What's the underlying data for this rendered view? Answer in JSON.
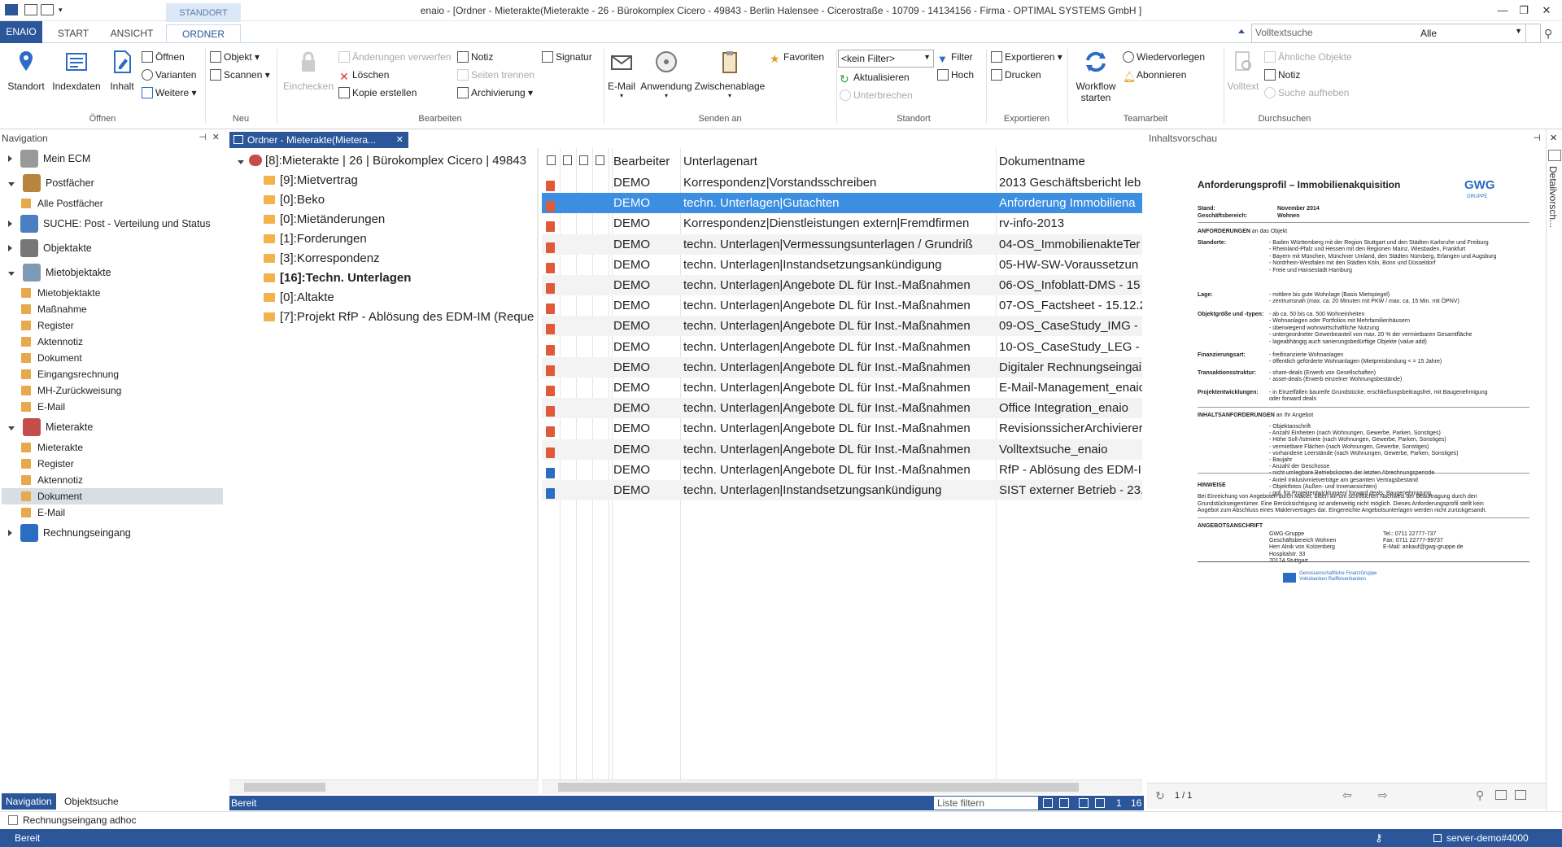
{
  "window": {
    "title": "enaio  - [Ordner - Mieterakte(Mieterakte - 26 - Bürokomplex Cicero - 49843 - Berlin Halensee - Cicerostraße - 10709 - 14134156 - Firma - OPTIMAL SYSTEMS GmbH ]",
    "minimize": "—",
    "restore": "❐",
    "close": "✕"
  },
  "ribbon_tabs": {
    "enaio": "ENAIO",
    "start": "START",
    "ansicht": "ANSICHT",
    "context_group": "STANDORT",
    "ordner": "ORDNER"
  },
  "search": {
    "placeholder": "Volltextsuche",
    "scope": "Alle"
  },
  "ribbon": {
    "oeffnen": {
      "label": "Öffnen",
      "standort": "Standort",
      "indexdaten": "Indexdaten",
      "inhalt": "Inhalt",
      "oeffnen_btn": "Öffnen",
      "varianten": "Varianten",
      "weitere": "Weitere"
    },
    "neu": {
      "label": "Neu",
      "objekt": "Objekt",
      "scannen": "Scannen"
    },
    "bearbeiten": {
      "label": "Bearbeiten",
      "einchecken": "Einchecken",
      "aenderungen": "Änderungen verwerfen",
      "loeschen": "Löschen",
      "kopie": "Kopie erstellen",
      "notiz": "Notiz",
      "seiten": "Seiten trennen",
      "archivierung": "Archivierung",
      "signatur": "Signatur"
    },
    "senden": {
      "label": "Senden an",
      "email": "E-Mail",
      "anwendung": "Anwendung",
      "zwischenablage": "Zwischenablage",
      "favoriten": "Favoriten"
    },
    "standort": {
      "label": "Standort",
      "filter_value": "<kein Filter>",
      "filter": "Filter",
      "hoch": "Hoch",
      "aktualisieren": "Aktualisieren",
      "unterbrechen": "Unterbrechen"
    },
    "exportieren": {
      "label": "Exportieren",
      "exportieren": "Exportieren",
      "drucken": "Drucken"
    },
    "teamarbeit": {
      "label": "Teamarbeit",
      "workflow": "Workflow starten",
      "wiedervorlegen": "Wiedervorlegen",
      "abonnieren": "Abonnieren"
    },
    "durchsuchen": {
      "label": "Durchsuchen",
      "volltext": "Volltext",
      "aehnliche": "Ähnliche Objekte",
      "notiz": "Notiz",
      "suche_aufheben": "Suche aufheben"
    }
  },
  "navigation": {
    "header": "Navigation",
    "items": [
      {
        "label": "Mein ECM",
        "level": 0
      },
      {
        "label": "Postfächer",
        "level": 0
      },
      {
        "label": "Alle Postfächer",
        "level": 1
      },
      {
        "label": "SUCHE: Post - Verteilung und Status",
        "level": 0
      },
      {
        "label": "Objektakte",
        "level": 0
      },
      {
        "label": "Mietobjektakte",
        "level": 0
      },
      {
        "label": "Mietobjektakte",
        "level": 1
      },
      {
        "label": "Maßnahme",
        "level": 1
      },
      {
        "label": "Register",
        "level": 1
      },
      {
        "label": "Aktennotiz",
        "level": 1
      },
      {
        "label": "Dokument",
        "level": 1
      },
      {
        "label": "Eingangsrechnung",
        "level": 1
      },
      {
        "label": "MH-Zurückweisung",
        "level": 1
      },
      {
        "label": "E-Mail",
        "level": 1
      },
      {
        "label": "Mieterakte",
        "level": 0
      },
      {
        "label": "Mieterakte",
        "level": 1
      },
      {
        "label": "Register",
        "level": 1
      },
      {
        "label": "Aktennotiz",
        "level": 1
      },
      {
        "label": "Dokument",
        "level": 1
      },
      {
        "label": "E-Mail",
        "level": 1
      },
      {
        "label": "Rechnungseingang",
        "level": 0
      }
    ],
    "tab_navigation": "Navigation",
    "tab_objektsuche": "Objektsuche"
  },
  "document_tab": "Ordner - Mieterakte(Mietera...",
  "folder_tree": {
    "root": "[8]:Mieterakte | 26 | Bürokomplex Cicero | 49843",
    "children": [
      "[9]:Mietvertrag",
      "[0]:Beko",
      "[0]:Mietänderungen",
      "[1]:Forderungen",
      "[3]:Korrespondenz",
      "[16]:Techn. Unterlagen",
      "[0]:Altakte",
      "[7]:Projekt RfP - Ablösung des EDM-IM (Reque"
    ]
  },
  "grid": {
    "columns": [
      "Bearbeiter",
      "Unterlagenart",
      "Dokumentname"
    ],
    "rows": [
      {
        "type": "pdf",
        "bearbeiter": "DEMO",
        "art": "Korrespondenz|Vorstandsschreiben",
        "name": "2013 Geschäftsbericht leb"
      },
      {
        "type": "pdf",
        "bearbeiter": "DEMO",
        "art": "techn. Unterlagen|Gutachten",
        "name": "Anforderung Immobiliena"
      },
      {
        "type": "pdf",
        "bearbeiter": "DEMO",
        "art": "Korrespondenz|Dienstleistungen extern|Fremdfirmen",
        "name": "rv-info-2013"
      },
      {
        "type": "pdf",
        "bearbeiter": "DEMO",
        "art": "techn. Unterlagen|Vermessungsunterlagen / Grundriß",
        "name": "04-OS_ImmobilienakteTer"
      },
      {
        "type": "pdf",
        "bearbeiter": "DEMO",
        "art": "techn. Unterlagen|Instandsetzungsankündigung",
        "name": "05-HW-SW-Voraussetzun"
      },
      {
        "type": "pdf",
        "bearbeiter": "DEMO",
        "art": "techn. Unterlagen|Angebote DL für Inst.-Maßnahmen",
        "name": "06-OS_Infoblatt-DMS - 15"
      },
      {
        "type": "pdf",
        "bearbeiter": "DEMO",
        "art": "techn. Unterlagen|Angebote DL für Inst.-Maßnahmen",
        "name": "07-OS_Factsheet - 15.12.2"
      },
      {
        "type": "pdf",
        "bearbeiter": "DEMO",
        "art": "techn. Unterlagen|Angebote DL für Inst.-Maßnahmen",
        "name": "09-OS_CaseStudy_IMG - 1"
      },
      {
        "type": "pdf",
        "bearbeiter": "DEMO",
        "art": "techn. Unterlagen|Angebote DL für Inst.-Maßnahmen",
        "name": "10-OS_CaseStudy_LEG - 1"
      },
      {
        "type": "pdf",
        "bearbeiter": "DEMO",
        "art": "techn. Unterlagen|Angebote DL für Inst.-Maßnahmen",
        "name": "Digitaler Rechnungseingai"
      },
      {
        "type": "pdf",
        "bearbeiter": "DEMO",
        "art": "techn. Unterlagen|Angebote DL für Inst.-Maßnahmen",
        "name": "E-Mail-Management_enaic"
      },
      {
        "type": "pdf",
        "bearbeiter": "DEMO",
        "art": "techn. Unterlagen|Angebote DL für Inst.-Maßnahmen",
        "name": "Office Integration_enaio"
      },
      {
        "type": "pdf",
        "bearbeiter": "DEMO",
        "art": "techn. Unterlagen|Angebote DL für Inst.-Maßnahmen",
        "name": "RevisionssicherArchivierer"
      },
      {
        "type": "pdf",
        "bearbeiter": "DEMO",
        "art": "techn. Unterlagen|Angebote DL für Inst.-Maßnahmen",
        "name": "Volltextsuche_enaio"
      },
      {
        "type": "word",
        "bearbeiter": "DEMO",
        "art": "techn. Unterlagen|Angebote DL für Inst.-Maßnahmen",
        "name": "RfP - Ablösung des EDM-I"
      },
      {
        "type": "word",
        "bearbeiter": "DEMO",
        "art": "techn. Unterlagen|Instandsetzungsankündigung",
        "name": "SIST externer Betrieb - 23."
      }
    ],
    "selected_index": 1
  },
  "status_main": {
    "text": "Bereit",
    "filter_placeholder": "Liste filtern",
    "count_a": "1",
    "count_b": "16"
  },
  "preview": {
    "header": "Inhaltsvorschau",
    "detail_label": "Detailvorsch...",
    "page_indicator": "1 / 1",
    "doc": {
      "title": "Anforderungsprofil – Immobilienakquisition",
      "logo": "GWG",
      "logo_sub": "GRUPPE",
      "stand_label": "Stand:",
      "stand": "November 2014",
      "bereich_label": "Geschäftsbereich:",
      "bereich": "Wohnen",
      "anforderungen": "ANFORDERUNGEN",
      "anforderungen_suffix": "an das Objekt",
      "standorte_label": "Standorte:",
      "standorte": [
        "- Baden Württemberg mit der Region Stuttgart und den Städten Karlsruhe und Freiburg",
        "- Rheinland-Pfalz und Hessen mit den Regionen Mainz, Wiesbaden, Frankfurt",
        "- Bayern mit München, Münchner Umland, den Städten Nürnberg, Erlangen und Augsburg",
        "- Nordrhein-Westfalen mit den Städten Köln, Bonn und Düsseldorf",
        "- Freie und Hansestadt Hamburg"
      ],
      "lage_label": "Lage:",
      "lage": [
        "- mittlere bis gute Wohnlage (Basis Mietspiegel)",
        "- zentrumsnah (max. ca. 20 Minuten mit PKW / max. ca. 15 Min. mit ÖPNV)"
      ],
      "objekt_label": "Objektgröße und -typen:",
      "objekt": [
        "- ab ca. 50 bis ca. 500 Wohneinheiten",
        "- Wohnanlagen oder Portfolios mit Mehrfamilienhäusern",
        "- überwiegend wohnwirtschaftliche Nutzung",
        "- untergeordneter Gewerbeanteil von max. 20 % der vermietbaren Gesamtfläche",
        "- lageabhängig auch sanierungsbedürftige Objekte (value add)"
      ],
      "finanz_label": "Finanzierungsart:",
      "finanz": [
        "- freifinanzierte Wohnanlagen",
        "- öffentlich geförderte Wohnanlagen (Mietpreisbindung < = 15 Jahre)"
      ],
      "trans_label": "Transaktionsstruktur:",
      "trans": [
        "- share-deals (Erwerb von Gesellschaften)",
        "- asset-deals (Erwerb einzelner Wohnungsbestände)"
      ],
      "projekt_label": "Projektentwicklungen:",
      "projekt": [
        "- in Einzelfällen baureife Grundstücke, erschließungsbeitragsfrei, mit Baugenehmigung",
        "  oder forward deals"
      ],
      "inhalt": "INHALTSANFORDERUNGEN",
      "inhalt_suffix": "an Ihr Angebot",
      "inhalt_items": [
        "- Objektanschrift",
        "- Anzahl Einheiten (nach Wohnungen, Gewerbe, Parken, Sonstiges)",
        "- Höhe Soll-/Istmiete (nach Wohnungen, Gewerbe, Parken, Sonstiges)",
        "- vermietbare Flächen (nach Wohnungen, Gewerbe, Sonstiges)",
        "- vorhandene Leerstände (nach Wohnungen, Gewerbe, Parken, Sonstiges)",
        "- Baujahr",
        "- Anzahl der Geschosse",
        "- nicht umlegbare Betriebskosten der letzten Abrechnungsperiode",
        "- Anteil Inklusivmietverträge am gesamten Vertragsbestand",
        "- Objektfotos (Außen- und Innenansichten)",
        "- ggf. für Projektentwicklungen/ forward deals: Baugenehmigung"
      ],
      "hinweise": "HINWEISE",
      "hinweise_text": [
        "Bei Einreichung von Angeboten durch Makler, bitten wir um schriftlichen Nachweis der Beauftragung durch den",
        "Grundstückseigentümer. Eine Berücksichtigung ist anderweitig nicht möglich. Dieses Anforderungsprofil stellt kein",
        "Angebot zum Abschluss eines Maklervertrages dar. Eingereichte Angebotsunterlagen werden nicht zurückgesandt."
      ],
      "anschrift": "ANGEBOTSANSCHRIFT",
      "anschrift_lines": [
        "GWG-Gruppe",
        "Geschäftsbereich Wohnen",
        "Herr Alnik von Kolzenberg",
        "Hospitalstr. 33",
        "70174 Stuttgart"
      ],
      "kontakt_lines": [
        "Tel.: 0711 22777-737",
        "Fax: 0711 22777-99737",
        "E-Mail: ankauf@gwg-gruppe.de"
      ],
      "footer_1": "Genossenschaftliche FinanzGruppe",
      "footer_2": "Volksbanken Raiffeisenbanken"
    }
  },
  "bottom_strip": "Rechnungseingang adhoc",
  "app_status": {
    "text": "Bereit",
    "server": "server-demo#4000"
  },
  "colors": {
    "accent": "#2b579a",
    "selection": "#3b8ee0"
  }
}
